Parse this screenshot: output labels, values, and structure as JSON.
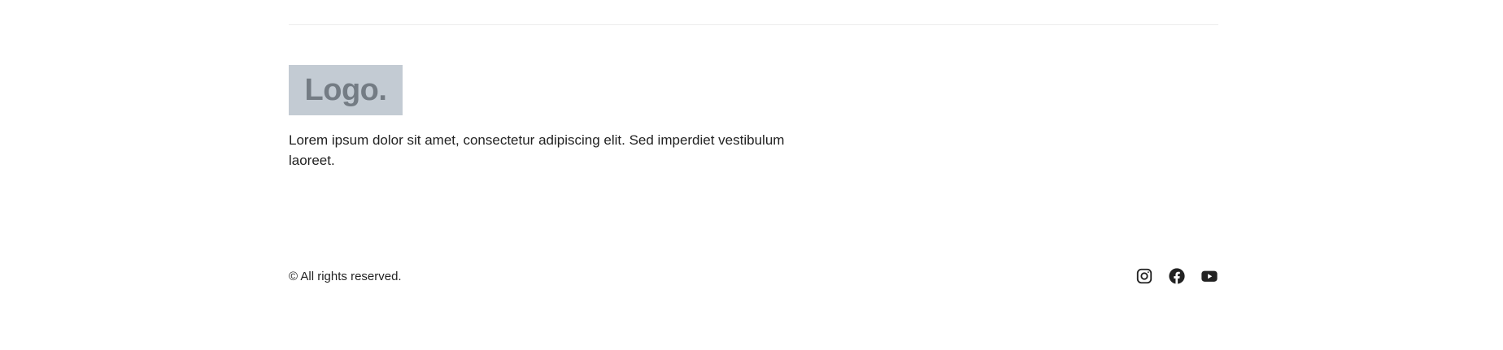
{
  "footer": {
    "logo_text": "Logo.",
    "description": "Lorem ipsum dolor sit amet, consectetur adipiscing elit. Sed imperdiet vestibulum laoreet.",
    "copyright": "© All rights reserved.",
    "social_icons": [
      "instagram-icon",
      "facebook-icon",
      "youtube-icon"
    ]
  },
  "colors": {
    "logo_background": "#c3cbd3",
    "logo_text": "#747c84",
    "text": "#222222",
    "divider": "#ececec"
  }
}
